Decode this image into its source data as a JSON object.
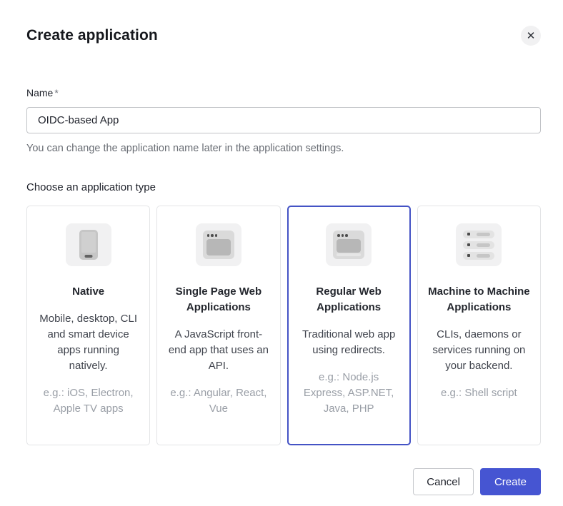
{
  "modal": {
    "title": "Create application",
    "close_icon": "✕"
  },
  "form": {
    "name_label": "Name",
    "required_marker": "*",
    "name_value": "OIDC-based App",
    "helper_text": "You can change the application name later in the application settings.",
    "type_label": "Choose an application type"
  },
  "app_types": [
    {
      "title": "Native",
      "description": "Mobile, desktop, CLI and smart device apps running natively.",
      "examples": "e.g.: iOS, Electron, Apple TV apps",
      "icon": "phone-icon",
      "selected": false
    },
    {
      "title": "Single Page Web Applications",
      "description": "A JavaScript front-end app that uses an API.",
      "examples": "e.g.: Angular, React, Vue",
      "icon": "browser-icon",
      "selected": false
    },
    {
      "title": "Regular Web Applications",
      "description": "Traditional web app using redirects.",
      "examples": "e.g.: Node.js Express, ASP.NET, Java, PHP",
      "icon": "browser-server-icon",
      "selected": true
    },
    {
      "title": "Machine to Machine Applications",
      "description": "CLIs, daemons or services running on your backend.",
      "examples": "e.g.: Shell script",
      "icon": "server-rack-icon",
      "selected": false
    }
  ],
  "footer": {
    "cancel_label": "Cancel",
    "create_label": "Create"
  },
  "colors": {
    "accent": "#4655d2",
    "selected_card_border": "#4453c5",
    "card_border": "#e3e4e6",
    "helper_text": "#696d74",
    "examples_text": "#999ea6",
    "icon_tile_bg": "#f1f1f2"
  }
}
